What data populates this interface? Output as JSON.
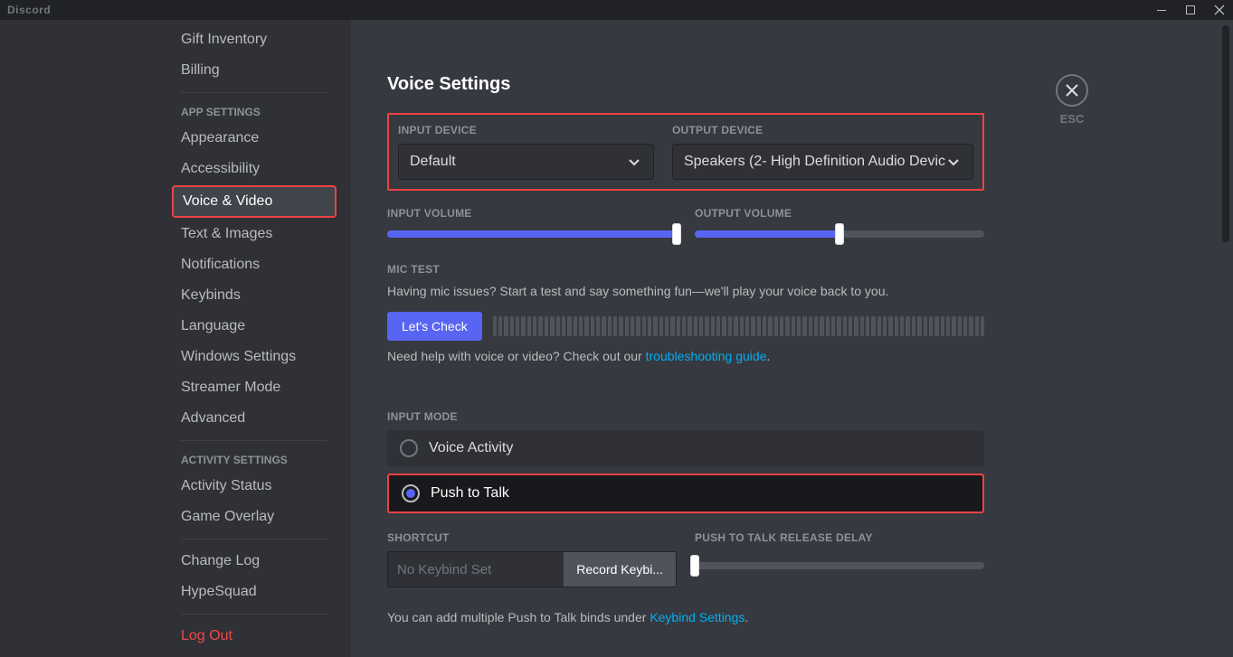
{
  "app_title": "Discord",
  "window_controls": {
    "min": "—",
    "max": "☐",
    "close": "✕"
  },
  "sidebar": {
    "top_items": [
      "Gift Inventory",
      "Billing"
    ],
    "app_heading": "APP SETTINGS",
    "app_items": [
      "Appearance",
      "Accessibility",
      "Voice & Video",
      "Text & Images",
      "Notifications",
      "Keybinds",
      "Language",
      "Windows Settings",
      "Streamer Mode",
      "Advanced"
    ],
    "activity_heading": "ACTIVITY SETTINGS",
    "activity_items": [
      "Activity Status",
      "Game Overlay"
    ],
    "bottom_items": [
      "Change Log",
      "HypeSquad"
    ],
    "logout": "Log Out",
    "active_index": 2
  },
  "close": {
    "esc": "ESC"
  },
  "page": {
    "title": "Voice Settings"
  },
  "devices": {
    "input_label": "INPUT DEVICE",
    "input_value": "Default",
    "output_label": "OUTPUT DEVICE",
    "output_value": "Speakers (2- High Definition Audio Devic"
  },
  "volumes": {
    "input_label": "INPUT VOLUME",
    "input_percent": 100,
    "output_label": "OUTPUT VOLUME",
    "output_percent": 50
  },
  "mic_test": {
    "heading": "MIC TEST",
    "desc": "Having mic issues? Start a test and say something fun—we'll play your voice back to you.",
    "button": "Let's Check"
  },
  "help": {
    "prefix": "Need help with voice or video? Check out our ",
    "link": "troubleshooting guide",
    "suffix": "."
  },
  "input_mode": {
    "heading": "INPUT MODE",
    "options": [
      "Voice Activity",
      "Push to Talk"
    ],
    "selected": 1
  },
  "shortcut": {
    "heading": "SHORTCUT",
    "placeholder": "No Keybind Set",
    "button": "Record Keybi..."
  },
  "delay": {
    "heading": "PUSH TO TALK RELEASE DELAY",
    "percent": 0
  },
  "ptt_help": {
    "prefix": "You can add multiple Push to Talk binds under ",
    "link": "Keybind Settings",
    "suffix": "."
  }
}
